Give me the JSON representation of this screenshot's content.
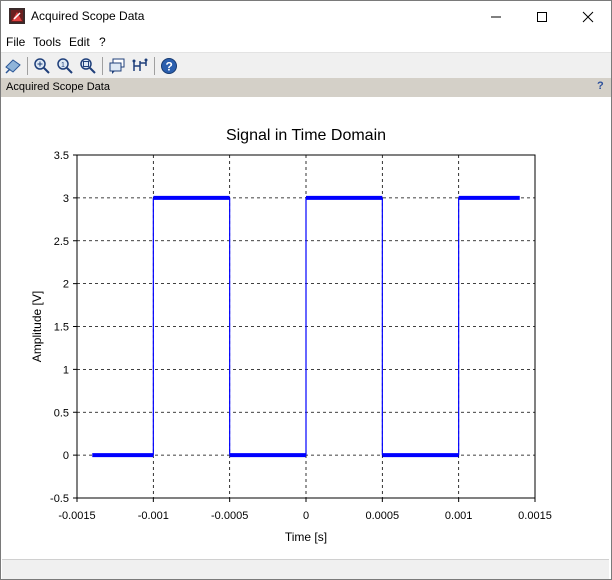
{
  "window": {
    "title": "Acquired Scope Data"
  },
  "menu": [
    "File",
    "Tools",
    "Edit",
    "?"
  ],
  "toolbar": {
    "icons": [
      "rotate-icon",
      "zoom-in-icon",
      "zoom-reset-icon",
      "zoom-fit-icon",
      "datatip-icon",
      "datatip-manager-icon",
      "help-icon"
    ]
  },
  "panel": {
    "title": "Acquired Scope Data",
    "help": "?"
  },
  "chart_data": {
    "type": "line",
    "title": "Signal in Time Domain",
    "xlabel": "Time [s]",
    "ylabel": "Amplitude [V]",
    "xlim": [
      -0.0015,
      0.0015
    ],
    "ylim": [
      -0.5,
      3.5
    ],
    "xticks": [
      "-0.0015",
      "-0.001",
      "-0.0005",
      "0",
      "0.0005",
      "0.001",
      "0.0015"
    ],
    "yticks": [
      "-0.5",
      "0",
      "0.5",
      "1",
      "1.5",
      "2",
      "2.5",
      "3",
      "3.5"
    ],
    "grid": true,
    "series": [
      {
        "color": "#0000ff",
        "x": [
          -0.0014,
          -0.001,
          -0.001,
          -0.0005,
          -0.0005,
          0.0,
          0.0,
          0.0005,
          0.0005,
          0.001,
          0.001,
          0.0014
        ],
        "y": [
          0,
          0,
          3,
          3,
          0,
          0,
          3,
          3,
          0,
          0,
          3,
          3
        ]
      }
    ]
  }
}
